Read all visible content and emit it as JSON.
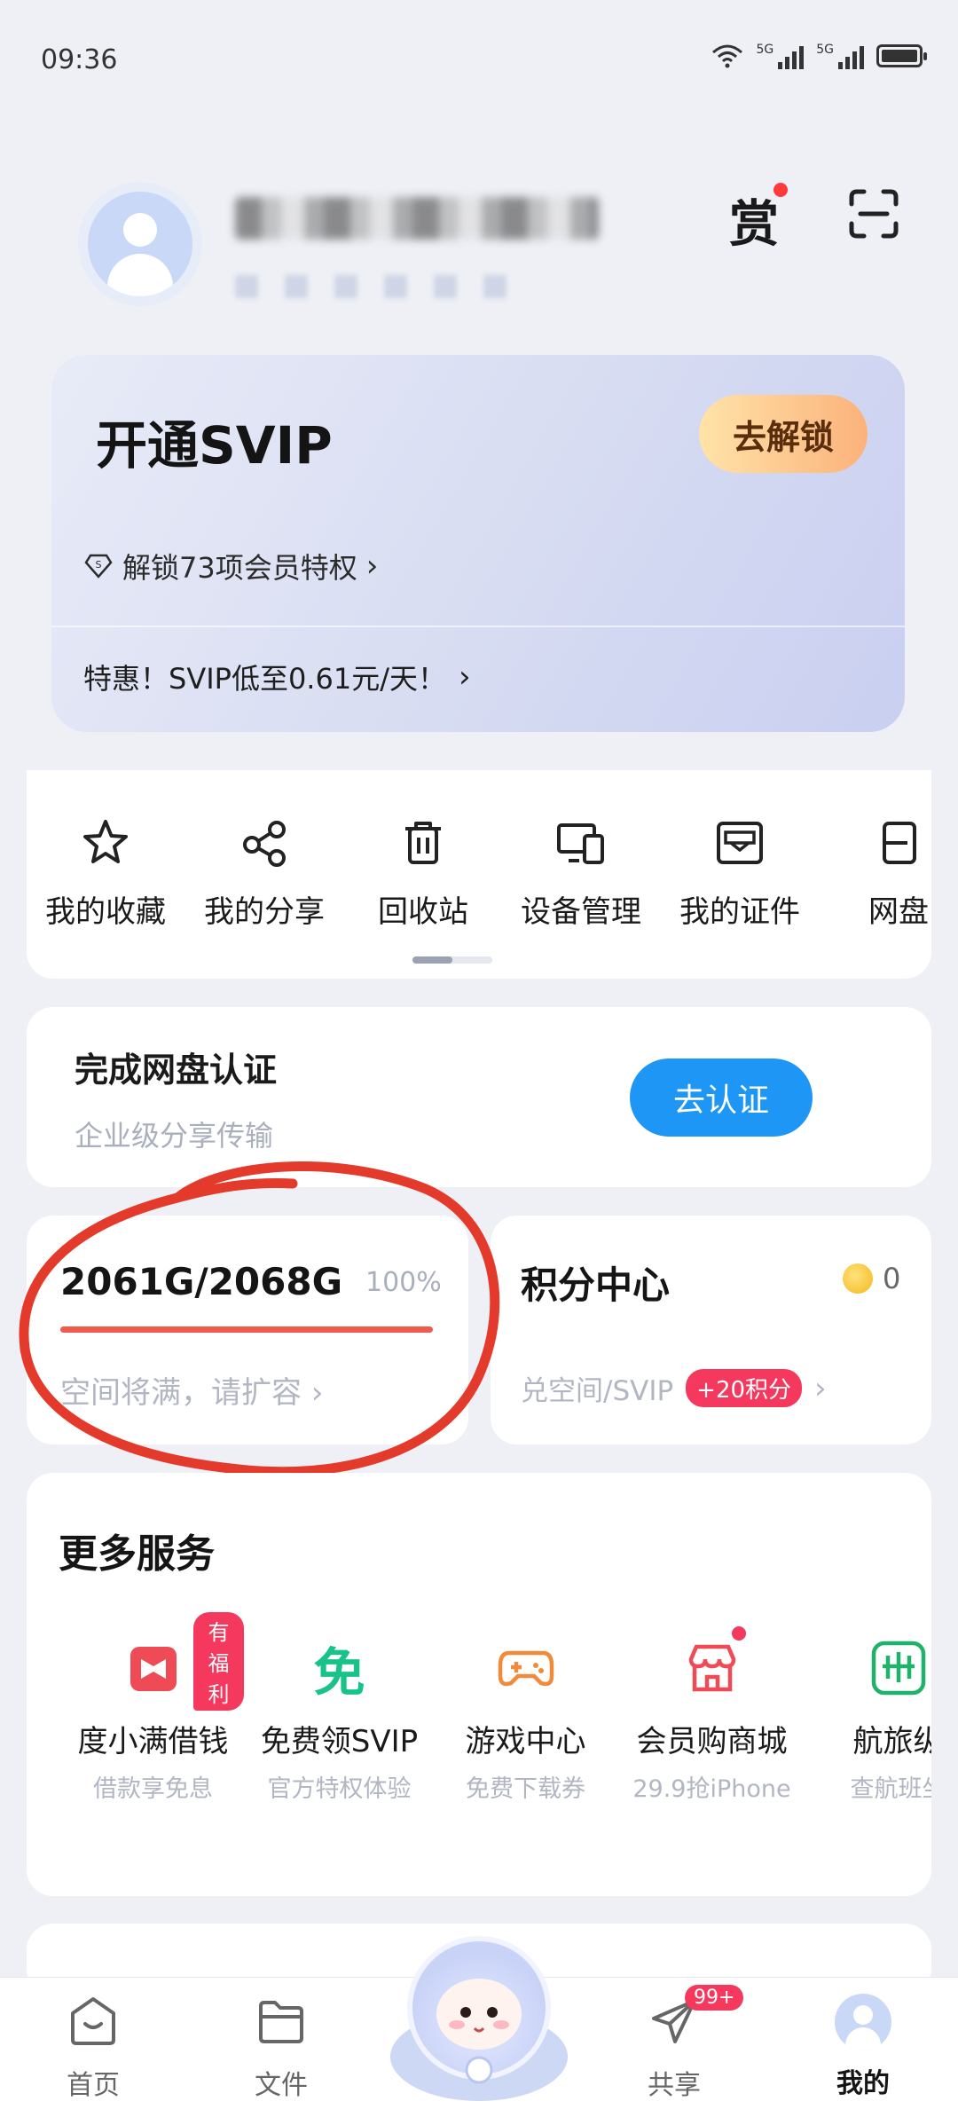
{
  "status_bar": {
    "time": "09:36",
    "network_label_1": "5G",
    "network_label_2": "5G"
  },
  "profile": {
    "reward_label": "赏"
  },
  "svip_card": {
    "title": "开通SVIP",
    "unlock_button": "去解锁",
    "privilege_text": "解锁73项会员特权",
    "promo_text": "特惠！SVIP低至0.61元/天！"
  },
  "shortcuts": [
    {
      "label": "我的收藏",
      "icon": "star-icon"
    },
    {
      "label": "我的分享",
      "icon": "share-icon"
    },
    {
      "label": "回收站",
      "icon": "trash-icon"
    },
    {
      "label": "设备管理",
      "icon": "devices-icon"
    },
    {
      "label": "我的证件",
      "icon": "id-card-icon"
    },
    {
      "label": "网盘",
      "icon": "netdisk-icon"
    }
  ],
  "certification": {
    "title": "完成网盘认证",
    "subtitle": "企业级分享传输",
    "button": "去认证"
  },
  "storage": {
    "value": "2061G/2068G",
    "percent": "100%",
    "fill_fraction": 1.0,
    "hint": "空间将满，请扩容"
  },
  "points": {
    "title": "积分中心",
    "coin_count": "0",
    "subtitle": "兑空间/SVIP",
    "badge": "+20积分"
  },
  "services": {
    "title": "更多服务",
    "items": [
      {
        "name": "度小满借钱",
        "desc": "借款享免息",
        "badge": "有福利",
        "icon": "loan-icon"
      },
      {
        "name": "免费领SVIP",
        "desc": "官方特权体验",
        "glyph": "免",
        "icon": "free-icon"
      },
      {
        "name": "游戏中心",
        "desc": "免费下载券",
        "icon": "gamepad-icon"
      },
      {
        "name": "会员购商城",
        "desc": "29.9抢iPhone",
        "icon": "store-icon"
      },
      {
        "name": "航旅纵",
        "desc": "查航班坐",
        "icon": "flight-icon"
      }
    ]
  },
  "bottom_nav": {
    "items": [
      {
        "label": "首页"
      },
      {
        "label": "文件"
      },
      {
        "label": "共享",
        "badge": "99+"
      },
      {
        "label": "我的"
      }
    ]
  },
  "colors": {
    "accent_blue": "#1e96f5",
    "alert_red": "#ef5b4c",
    "badge_pink": "#f5385e",
    "gold": "#fbb27b"
  }
}
